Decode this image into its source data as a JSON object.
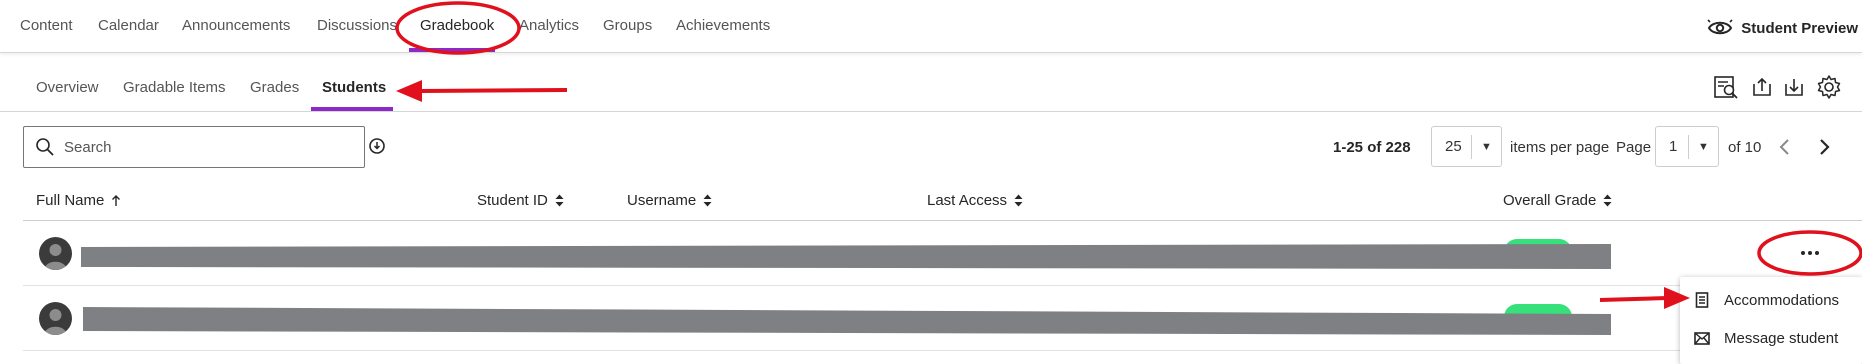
{
  "top_nav": {
    "items": [
      "Content",
      "Calendar",
      "Announcements",
      "Discussions",
      "Gradebook",
      "Analytics",
      "Groups",
      "Achievements"
    ],
    "active": "Gradebook",
    "student_preview_label": "Student Preview"
  },
  "sub_nav": {
    "items": [
      "Overview",
      "Gradable Items",
      "Grades",
      "Students"
    ],
    "active": "Students",
    "tool_icons": [
      "report-icon",
      "upload-icon",
      "download-icon",
      "settings-icon"
    ]
  },
  "search": {
    "placeholder": "Search"
  },
  "pagination": {
    "range_label": "1-25 of 228",
    "per_page_value": "25",
    "items_per_page_label": "items per page",
    "page_label": "Page",
    "page_value": "1",
    "of_label": "of 10"
  },
  "table": {
    "columns": [
      "Full Name",
      "Student ID",
      "Username",
      "Last Access",
      "Overall Grade"
    ]
  },
  "row_menu": {
    "items": [
      "Accommodations",
      "Message student"
    ]
  },
  "colors": {
    "accent": "#8e29c7",
    "annotation_red": "#e0101d",
    "grade_pill": "#36e07a",
    "redaction": "#7f8084"
  }
}
